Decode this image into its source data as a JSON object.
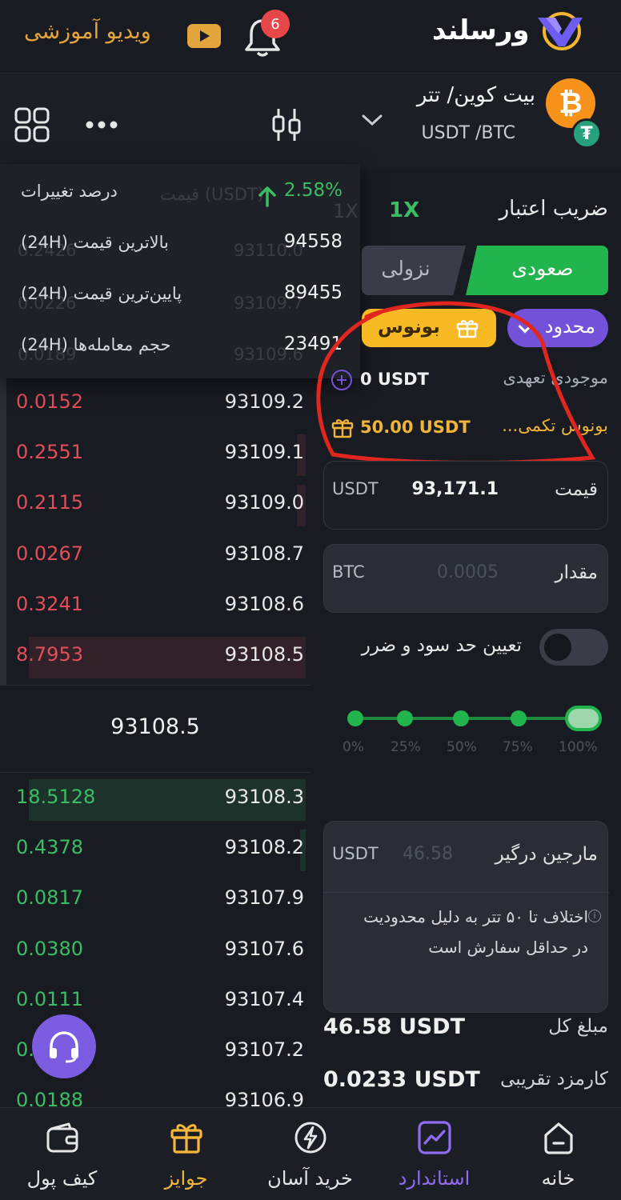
{
  "header": {
    "brand": "ورسلند",
    "notification_count": "6",
    "video_label": "ویدیو آموزشی"
  },
  "pair": {
    "title": "بیت کوین/ تتر",
    "symbol": "USDT /BTC",
    "base_coin": "₿",
    "quote_coin": "₮"
  },
  "stats": {
    "change_label": "درصد تغییرات",
    "change_value": "2.58%",
    "high_label": "بالاترین قیمت (24H)",
    "high_value": "94558",
    "low_label": "پایین‌ترین قیمت (24H)",
    "low_value": "89455",
    "volume_label": "حجم معامله‌ها (24H)",
    "volume_value": "23491",
    "hidden_header": "قیمت (USDT)"
  },
  "orderbook": {
    "asks": [
      {
        "amount": "0.0152",
        "price": "93109.2",
        "depth": 0.0
      },
      {
        "amount": "0.2551",
        "price": "93109.1",
        "depth": 0.03
      },
      {
        "amount": "0.2115",
        "price": "93109.0",
        "depth": 0.03
      },
      {
        "amount": "0.0267",
        "price": "93108.7",
        "depth": 0.0
      },
      {
        "amount": "0.3241",
        "price": "93108.6",
        "depth": 0.0
      },
      {
        "amount": "8.7953",
        "price": "93108.5",
        "depth": 0.96
      }
    ],
    "hidden_asks": [
      "0.2426",
      "0.0226",
      "0.0189"
    ],
    "hidden_ask_prices": [
      "93110.0",
      "93109.7",
      "93109.6"
    ],
    "mid_price": "93108.5",
    "bids": [
      {
        "amount": "18.5128",
        "price": "93108.3",
        "depth": 0.96
      },
      {
        "amount": "0.4378",
        "price": "93108.2",
        "depth": 0.02
      },
      {
        "amount": "0.0817",
        "price": "93107.9",
        "depth": 0.0
      },
      {
        "amount": "0.0380",
        "price": "93107.6",
        "depth": 0.0
      },
      {
        "amount": "0.0111",
        "price": "93107.4",
        "depth": 0.0
      },
      {
        "amount": "0.",
        "price": "93107.2",
        "depth": 0.0
      },
      {
        "amount": "0.0188",
        "price": "93106.9",
        "depth": 0.0
      }
    ]
  },
  "trade": {
    "leverage_label": "ضریب اعتبار",
    "leverage_value": "1X",
    "leverage_ghost": "1X",
    "short_label": "نزولی",
    "long_label": "صعودی",
    "order_type": "محدود",
    "bonus_button": "بونوس",
    "available_label": "موجودی تعهدی",
    "available_value": "0 USDT",
    "bonus_label": "بونوس تکمی...",
    "bonus_value": "50.00 USDT",
    "price_label": "قیمت",
    "price_value": "93,171.1",
    "price_unit": "USDT",
    "amount_label": "مقدار",
    "amount_placeholder": "0.0005",
    "amount_unit": "BTC",
    "tpsl_label": "تعیین حد سود و ضرر",
    "slider_marks": [
      "0%",
      "25%",
      "50%",
      "75%",
      "100%"
    ],
    "slider_value": 1.0,
    "margin_label": "مارجین درگیر",
    "margin_value": "46.58",
    "margin_unit": "USDT",
    "margin_note": "اختلاف تا ۵۰ تتر به دلیل محدودیت در حداقل سفارش است",
    "total_label": "مبلغ کل",
    "total_value": "46.58 USDT",
    "fee_label": "کارمزد تقریبی",
    "fee_value": "0.0233 USDT"
  },
  "nav": {
    "items": [
      {
        "label": "کیف پول",
        "icon": "wallet-icon"
      },
      {
        "label": "جوایز",
        "icon": "gift-icon"
      },
      {
        "label": "خرید آسان",
        "icon": "flash-icon"
      },
      {
        "label": "استاندارد",
        "icon": "chart-icon"
      },
      {
        "label": "خانه",
        "icon": "home-icon"
      }
    ]
  },
  "colors": {
    "background": "#191b22",
    "positive": "#3bbd63",
    "negative": "#e24e59",
    "accent_purple": "#7352d9",
    "gold": "#f7b924"
  }
}
